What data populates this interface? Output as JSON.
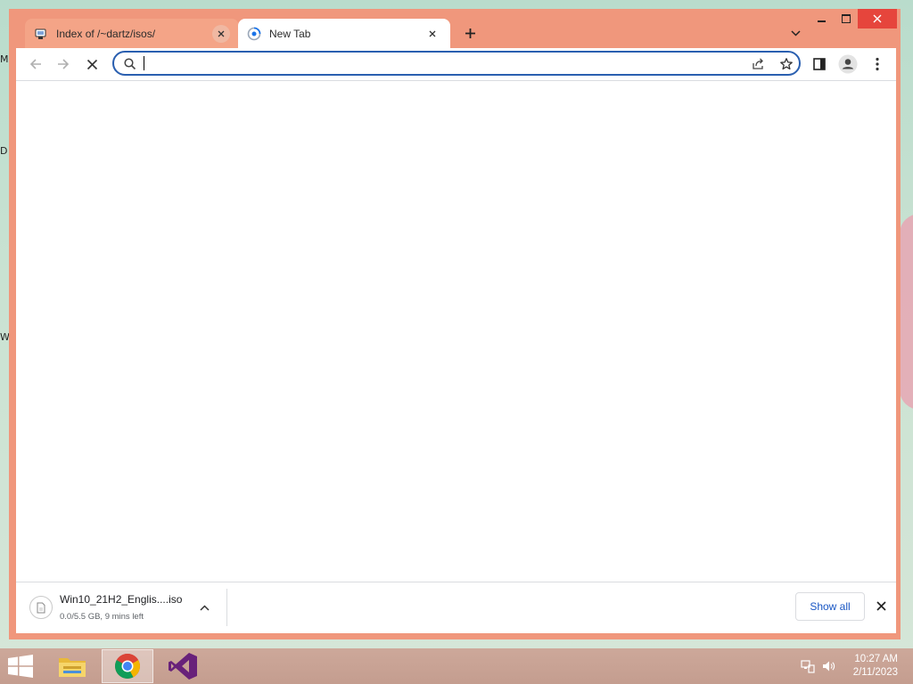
{
  "desktop": {
    "edge_labels": [
      "M",
      "D",
      "W"
    ]
  },
  "browser": {
    "tabs": [
      {
        "title": "Index of /~dartz/isos/",
        "active": false
      },
      {
        "title": "New Tab",
        "active": true
      }
    ],
    "omnibox": {
      "value": "",
      "placeholder": ""
    },
    "accent_color": "#2a5fb0",
    "frame_color": "#f0977c"
  },
  "download_shelf": {
    "item": {
      "filename": "Win10_21H2_Englis....iso",
      "status": "0.0/5.5 GB, 9 mins left"
    },
    "show_all_label": "Show all"
  },
  "taskbar": {
    "apps": [
      "file-explorer-icon",
      "chrome-icon",
      "visual-studio-icon"
    ],
    "clock": {
      "time": "10:27 AM",
      "date": "2/11/2023"
    }
  }
}
